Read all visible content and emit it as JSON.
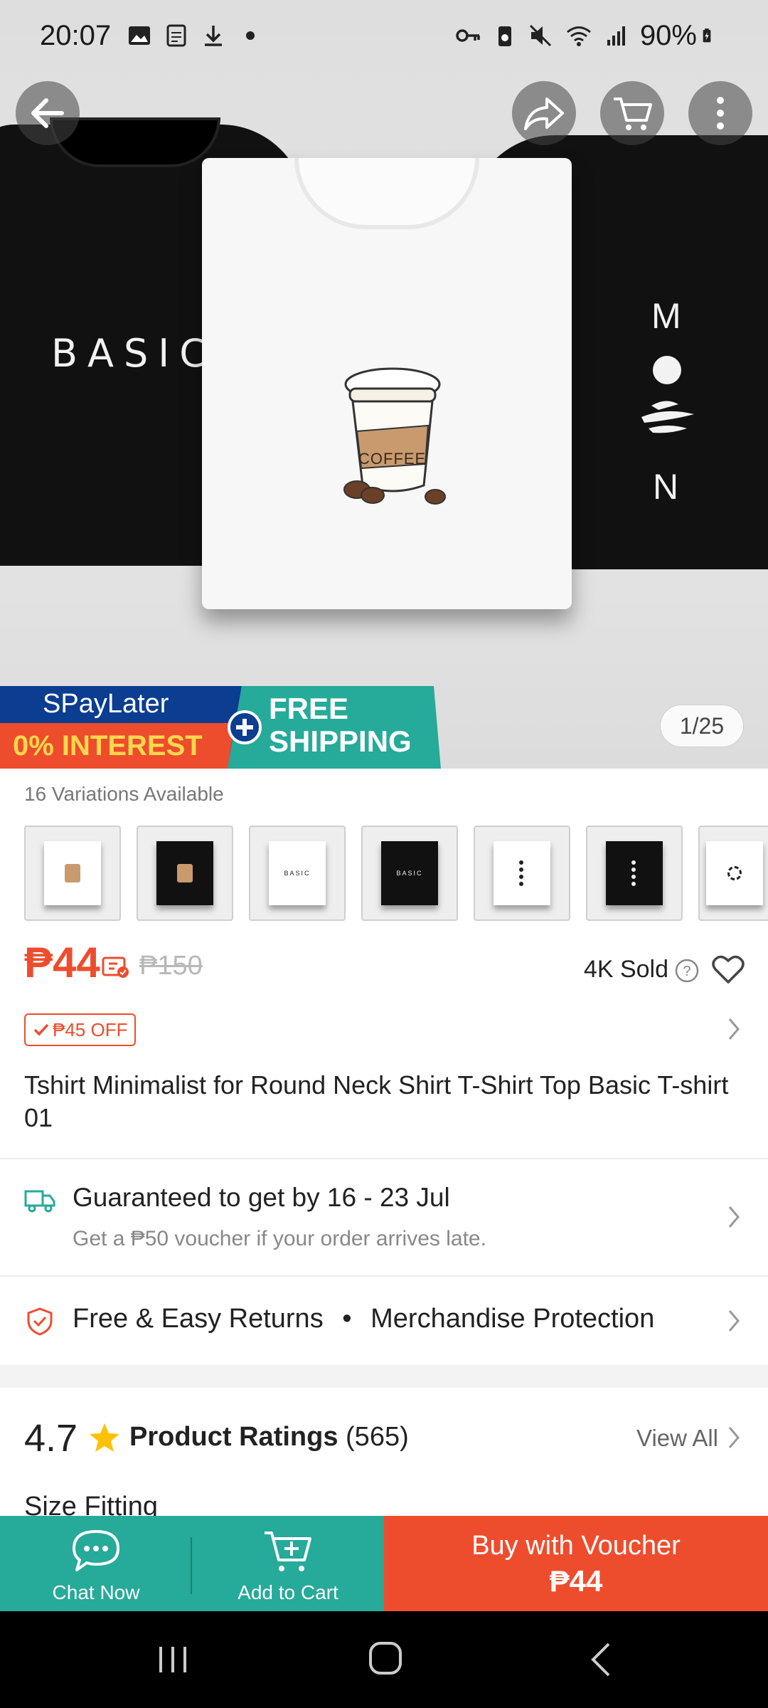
{
  "status_bar": {
    "time": "20:07",
    "battery": "90%"
  },
  "hero": {
    "shirt_left_text": "BASIC",
    "shirt_right_letters": [
      "M",
      "N"
    ],
    "cup_text": "COFFEE",
    "page_indicator": "1/25"
  },
  "promo": {
    "spaylater": "SPayLater",
    "interest": "0% INTEREST",
    "free": "FREE",
    "shipping": "SHIPPING"
  },
  "variations": {
    "label": "16 Variations Available",
    "items": [
      {
        "color": "#ffffff",
        "print": "coffee"
      },
      {
        "color": "#111111",
        "print": "coffee"
      },
      {
        "color": "#ffffff",
        "print": "BASIC"
      },
      {
        "color": "#111111",
        "print": "BASIC"
      },
      {
        "color": "#ffffff",
        "print": "moon"
      },
      {
        "color": "#111111",
        "print": "moon"
      },
      {
        "color": "#ffffff",
        "print": "sun"
      }
    ]
  },
  "price": {
    "current": "₱44",
    "original": "₱150",
    "sold": "4K Sold",
    "discount": "₱45 OFF"
  },
  "product": {
    "title": "Tshirt Minimalist for Round Neck Shirt T-Shirt Top Basic T-shirt 01"
  },
  "delivery": {
    "title": "Guaranteed to get by 16 - 23 Jul",
    "subtitle": "Get a ₱50 voucher if your order arrives late."
  },
  "returns": {
    "label1": "Free & Easy Returns",
    "separator": "•",
    "label2": "Merchandise Protection"
  },
  "ratings": {
    "score": "4.7",
    "label": "Product Ratings",
    "count": "(565)",
    "view_all": "View All"
  },
  "size_fitting": "Size Fitting",
  "bottom_bar": {
    "chat": "Chat Now",
    "cart": "Add to Cart",
    "buy": "Buy with Voucher",
    "buy_price": "₱44"
  },
  "colors": {
    "accent": "#ee4d2d",
    "teal": "#26aa99"
  }
}
